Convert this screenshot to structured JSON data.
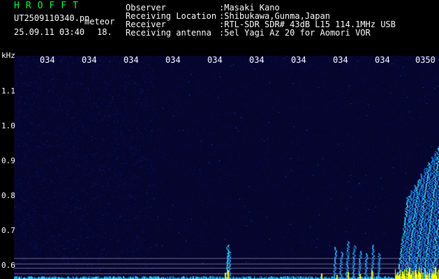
{
  "header": {
    "title": "HROFFT",
    "file_name": "UT2509110340.pn",
    "subtitle": "meteor",
    "datetime": "25.09.11 03:40",
    "counter": "18."
  },
  "info": [
    {
      "label": "Observer",
      "value": ":Masaki Kano"
    },
    {
      "label": "Receiving Location",
      "value": ":Shibukawa,Gunma,Japan"
    },
    {
      "label": "Receiver",
      "value": ":RTL-SDR SDR# 43dB L15 114.1MHz USB"
    },
    {
      "label": "Receiving antenna",
      "value": ":5el Yagi Az 20 for Aomori VOR"
    }
  ],
  "axis": {
    "unit": "kHz",
    "time_ticks": [
      "034",
      "034",
      "034",
      "034",
      "034",
      "034",
      "034",
      "034",
      "034",
      "0350"
    ],
    "freq_ticks": [
      "1.1",
      "1.0",
      "0.9",
      "0.8",
      "0.7",
      "0.6"
    ]
  },
  "colors": {
    "title": "#00ff3c",
    "background_noise": "#0a0a4a",
    "signal": "#00c8ff",
    "strong": "#ffff00"
  }
}
